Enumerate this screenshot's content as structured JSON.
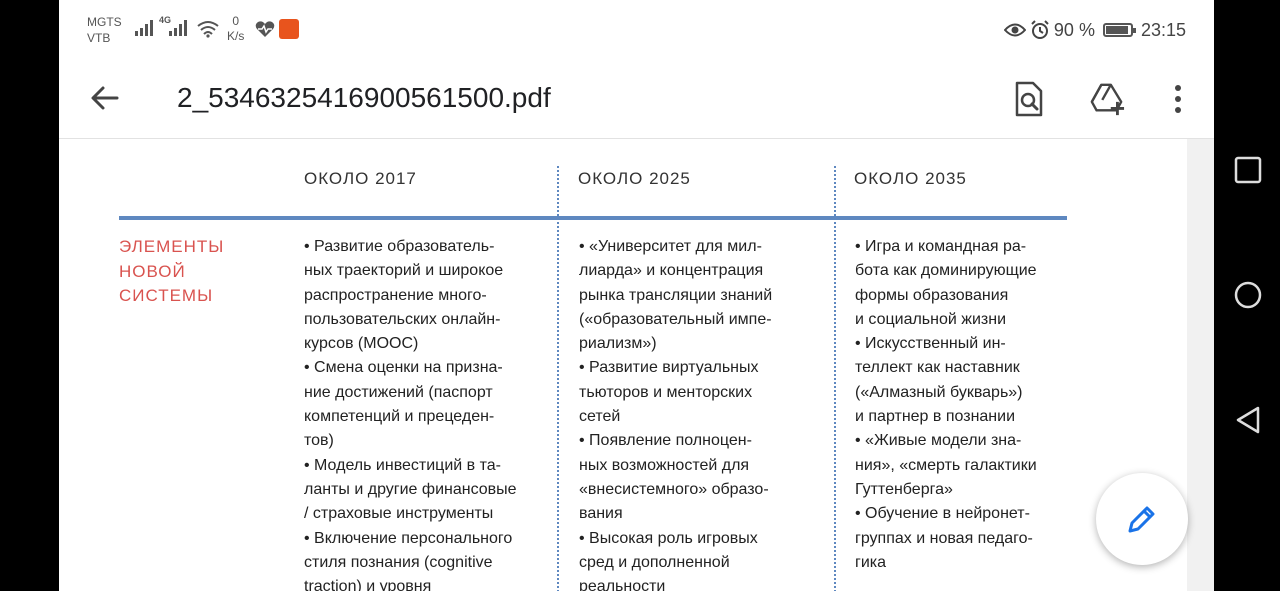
{
  "status_bar": {
    "carrier_1": "MGTS",
    "carrier_2": "VTB",
    "net_type": "4G",
    "speed_value": "0",
    "speed_unit": "K/s",
    "battery_percent": "90 %",
    "battery_level": 0.9,
    "time": "23:15"
  },
  "toolbar": {
    "file_title": "2_5346325416900561500.pdf"
  },
  "document": {
    "columns": [
      "ОКОЛО 2017",
      "ОКОЛО 2025",
      "ОКОЛО 2035"
    ],
    "row_label": [
      "ЭЛЕМЕНТЫ",
      "НОВОЙ",
      "СИСТЕМЫ"
    ],
    "cells": [
      [
        "• Развитие образователь-",
        "ных траекторий и широкое",
        "распространение много-",
        "пользовательских онлайн-",
        "курсов (MOOC)",
        "• Смена оценки на призна-",
        "ние достижений (паспорт",
        "компетенций и прецеден-",
        "тов)",
        "• Модель инвестиций в та-",
        "ланты и другие финансовые",
        "/ страховые инструменты",
        "• Включение персонального",
        "стиля познания (cognitive",
        "traction) и уровня"
      ],
      [
        "• «Университет для мил-",
        "лиарда» и концентрация",
        "рынка трансляции знаний",
        "(«образовательный импе-",
        "риализм»)",
        "• Развитие виртуальных",
        "тьюторов и менторских",
        "сетей",
        "• Появление полноцен-",
        "ных возможностей для",
        "«внесистемного» образо-",
        "вания",
        "• Высокая роль игровых",
        "сред и дополненной",
        "реальности"
      ],
      [
        "• Игра и командная ра-",
        "бота как доминирующие",
        "формы образования",
        "и социальной жизни",
        "• Искусственный ин-",
        "теллект как наставник",
        "(«Алмазный букварь»)",
        "и партнер в познании",
        "• «Живые модели зна-",
        "ния», «смерть галактики",
        "Гуттенберга»",
        "• Обучение в нейронет-",
        "группах и новая педаго-",
        "гика"
      ]
    ]
  },
  "colors": {
    "accent_blue": "#5e88c0",
    "label_red": "#d9534f",
    "fab_blue": "#1a73e8"
  }
}
